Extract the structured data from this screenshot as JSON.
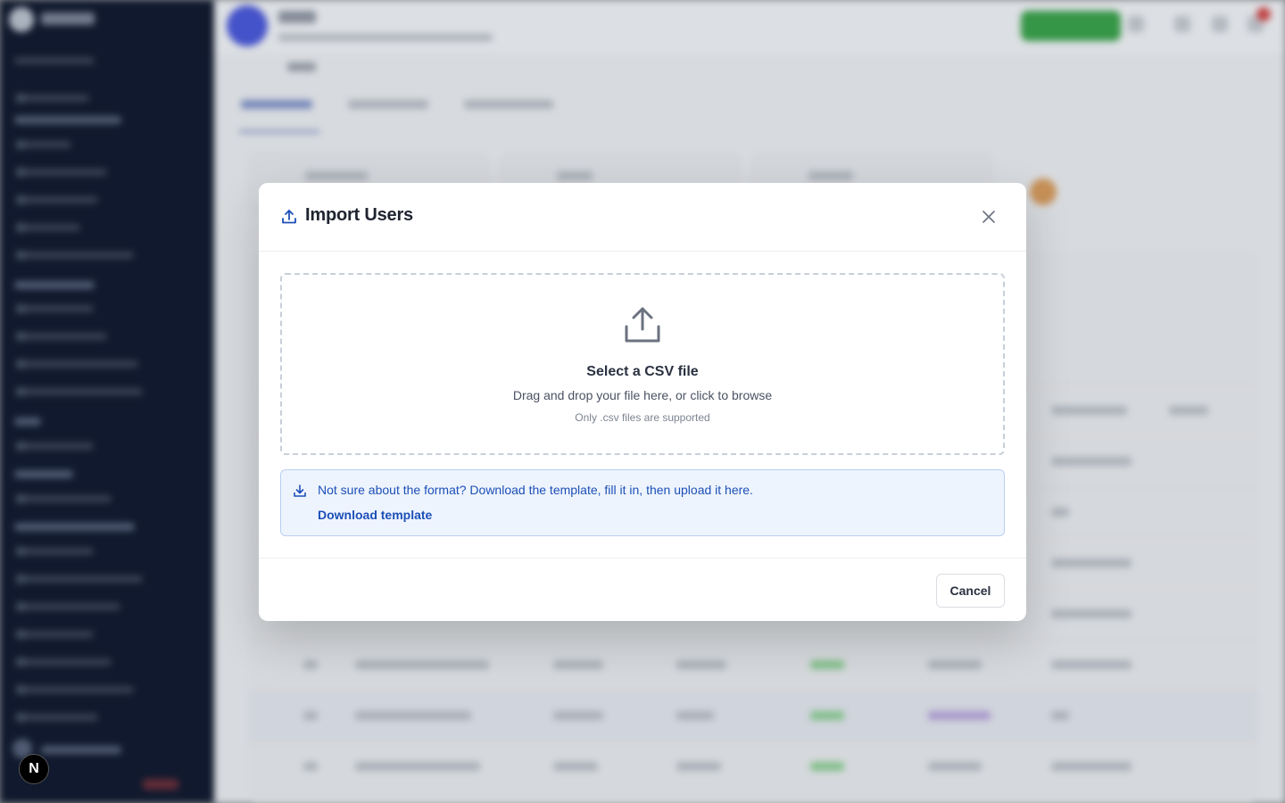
{
  "modal": {
    "title": "Import Users",
    "close_label": "×",
    "dropzone": {
      "title": "Select a CSV file",
      "subtitle": "Drag and drop your file here, or click to browse",
      "note": "Only .csv files are supported"
    },
    "info": {
      "text": "Not sure about the format? Download the template, fill it in, then upload it here.",
      "link": "Download template"
    },
    "cancel_label": "Cancel"
  },
  "nextjs_badge": "N",
  "colors": {
    "accent": "#1c4fb8",
    "info_bg": "#eef4fd",
    "sidebar_bg": "#111a2e"
  },
  "icons": [
    "upload-icon",
    "close-icon",
    "cloud-upload-icon",
    "download-icon"
  ]
}
